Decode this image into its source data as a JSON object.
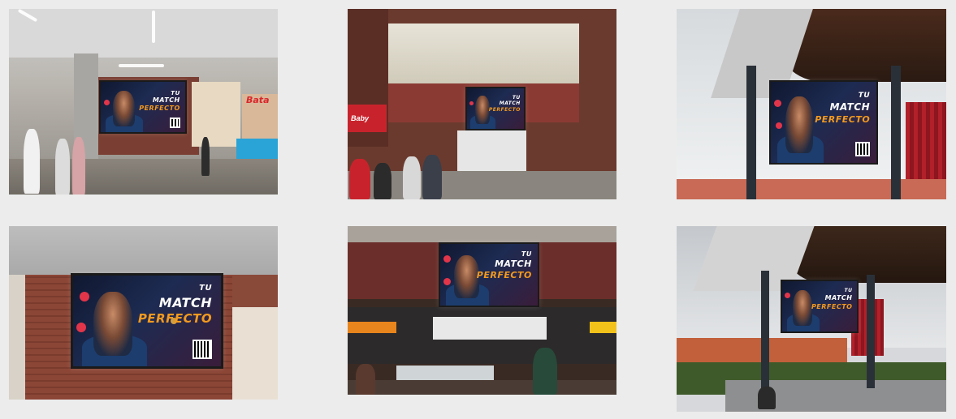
{
  "photos": [
    {
      "screen": {
        "line1": "TU",
        "line2": "MATCH",
        "line3": "PERFECTO",
        "tagline": ""
      }
    },
    {
      "screen": {
        "line1": "TU",
        "line2": "MATCH",
        "line3": "PERFECTO",
        "tagline": ""
      }
    },
    {
      "screen": {
        "line1": "TU",
        "line2": "MATCH",
        "line3": "PERFECTO",
        "tagline": ""
      }
    },
    {
      "screen": {
        "line1": "TU",
        "line2": "MATCH",
        "line3": "PERFECTO",
        "tagline": ""
      }
    },
    {
      "screen": {
        "line1": "TU",
        "line2": "MATCH",
        "line3": "PERFECTO",
        "tagline": ""
      }
    },
    {
      "screen": {
        "line1": "TU",
        "line2": "MATCH",
        "line3": "PERFECTO",
        "tagline": ""
      }
    }
  ],
  "store_signs": {
    "photo1": "Bata",
    "photo2": "Baby"
  },
  "colors": {
    "background": "#ececec",
    "accent_orange": "#f39a1f",
    "accent_red": "#e2354a"
  }
}
